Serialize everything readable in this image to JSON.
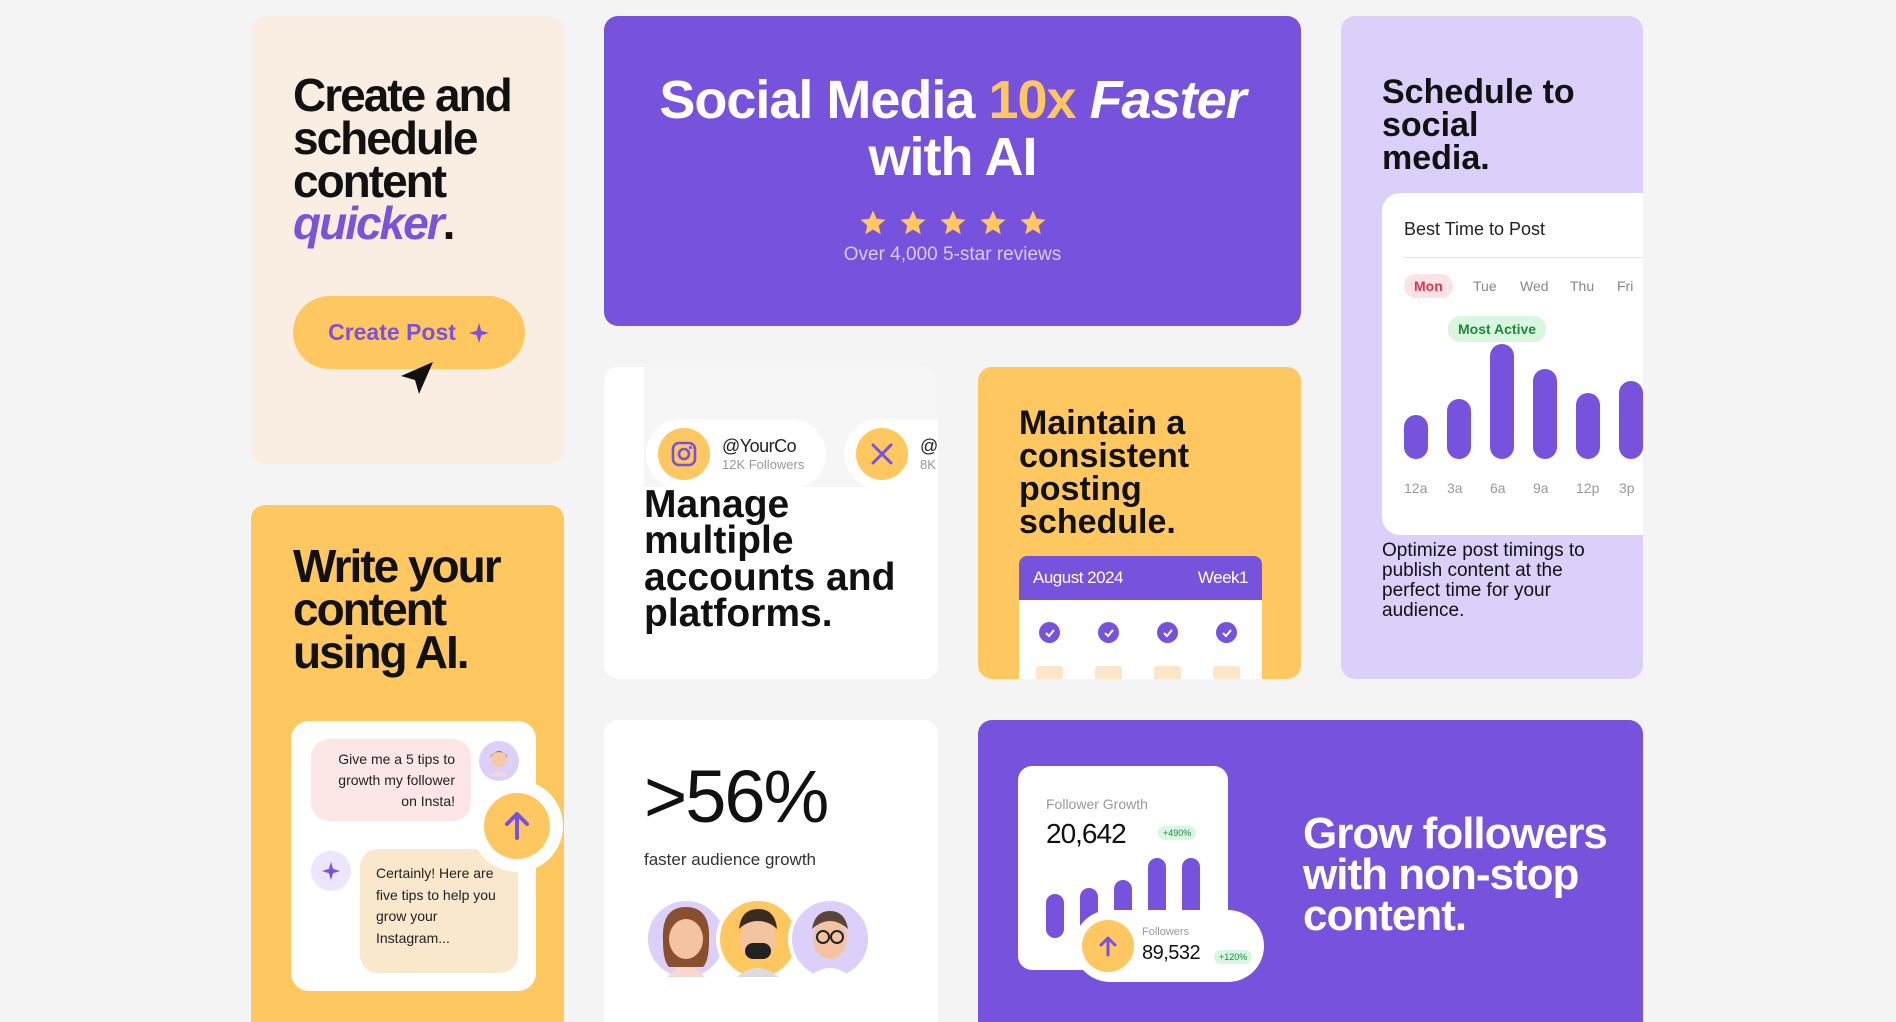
{
  "card_create": {
    "title_line1": "Create and",
    "title_line2": "schedule",
    "title_line3": "content",
    "title_accent": "quicker",
    "title_period": ".",
    "button_label": "Create Post"
  },
  "hero": {
    "title_part1": "Social Media ",
    "title_accent": "10x",
    "title_italic": " Faster",
    "title_line2": "with AI",
    "rating_stars": 5,
    "reviews": "Over 4,000 5-star reviews"
  },
  "schedule": {
    "title_line1": "Schedule to",
    "title_line2": "social",
    "title_line3": "media.",
    "panel_title": "Best Time to Post",
    "days": [
      "Mon",
      "Tue",
      "Wed",
      "Thu",
      "Fri"
    ],
    "active_day": "Mon",
    "badge": "Most Active",
    "hours": [
      "12a",
      "3a",
      "6a",
      "9a",
      "12p",
      "3p"
    ],
    "activity_levels": [
      0.38,
      0.52,
      1.0,
      0.78,
      0.57,
      0.68
    ],
    "description": "Optimize post timings to publish content at the perfect time for your audience."
  },
  "ai_write": {
    "title_line1": "Write your",
    "title_line2": "content",
    "title_line3": "using AI.",
    "user_message": "Give me a 5 tips to growth my follower on Insta!",
    "ai_reply": "Certainly! Here are five tips to help you grow your Instagram..."
  },
  "accounts": {
    "items": [
      {
        "handle": "@YourCo",
        "followers": "12K Followers",
        "icon": "instagram-icon"
      },
      {
        "handle": "@",
        "followers": "8K",
        "icon": "x-icon"
      }
    ],
    "title_line1": "Manage",
    "title_line2": "multiple",
    "title_line3": "accounts and",
    "title_line4": "platforms."
  },
  "consistent": {
    "title_line1": "Maintain a",
    "title_line2": "consistent",
    "title_line3": "posting",
    "title_line4": "schedule.",
    "calendar_month": "August 2024",
    "calendar_week": "Week1"
  },
  "growth_stat": {
    "value": ">56%",
    "caption": "faster audience growth"
  },
  "followers": {
    "label": "Follower Growth",
    "value": "20,642",
    "change": "+490%",
    "bar_levels": [
      0.55,
      0.62,
      0.72,
      1.0,
      1.0
    ],
    "sub_label": "Followers",
    "sub_value": "89,532",
    "sub_change": "+120%",
    "title_line1": "Grow followers",
    "title_line2": "with non-stop",
    "title_line3": "content."
  },
  "colors": {
    "purple": "#7752dd",
    "yellow": "#ffc75f",
    "cream": "#faeee2",
    "lavender": "#dcd0fb"
  }
}
